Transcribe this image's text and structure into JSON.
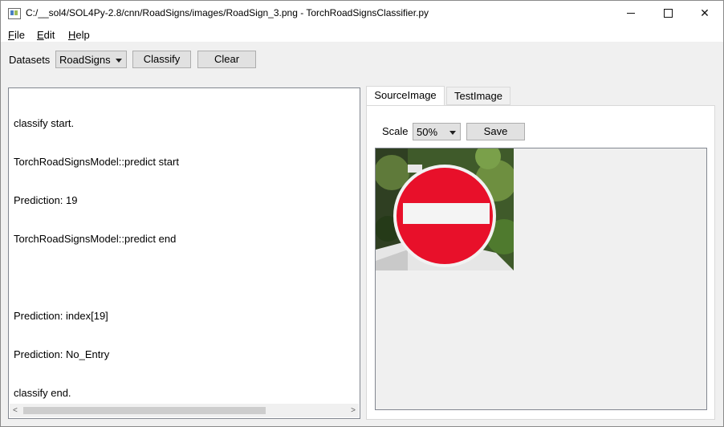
{
  "window": {
    "title": "C:/__sol4/SOL4Py-2.8/cnn/RoadSigns/images/RoadSign_3.png - TorchRoadSignsClassifier.py",
    "minimize_glyph": "—",
    "maximize_glyph": "☐",
    "close_glyph": "✕"
  },
  "menu": {
    "file": {
      "accel": "F",
      "rest": "ile"
    },
    "edit": {
      "accel": "E",
      "rest": "dit"
    },
    "help": {
      "accel": "H",
      "rest": "elp"
    }
  },
  "toolbar": {
    "datasets_label": "Datasets",
    "dataset_selected": "RoadSigns",
    "classify_label": "Classify",
    "clear_label": "Clear"
  },
  "output": {
    "lines": [
      "classify start.",
      "TorchRoadSignsModel::predict start",
      "Prediction: 19",
      "TorchRoadSignsModel::predict end",
      "",
      "Prediction: index[19]",
      "Prediction: No_Entry",
      "classify end."
    ],
    "scroll_left_glyph": "<",
    "scroll_right_glyph": ">"
  },
  "tabs": [
    {
      "label": "SourceImage",
      "active": true
    },
    {
      "label": "TestImage",
      "active": false
    }
  ],
  "image_panel": {
    "scale_label": "Scale",
    "scale_selected": "50%",
    "save_label": "Save"
  },
  "icons": {
    "app": "app-window-icon",
    "combo_arrow": "chevron-down-icon"
  }
}
